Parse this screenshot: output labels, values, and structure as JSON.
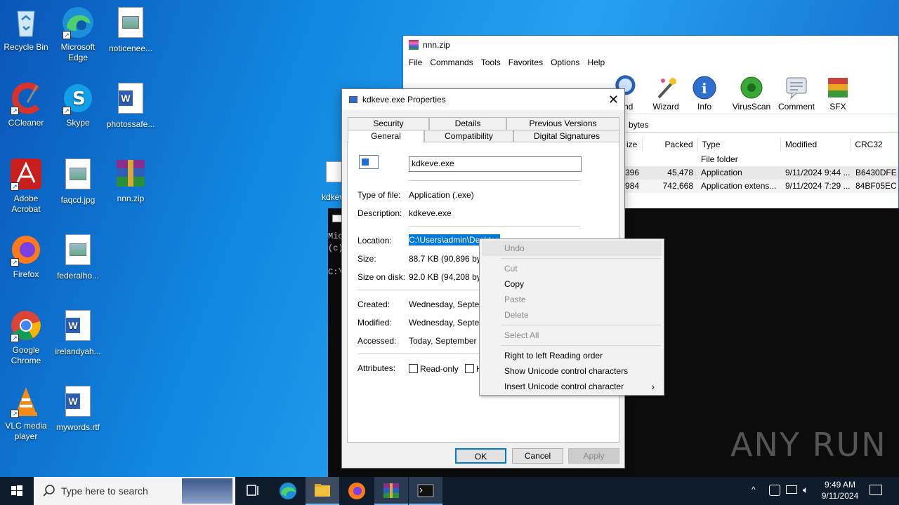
{
  "desktop": {
    "icons": [
      {
        "label": "Recycle Bin"
      },
      {
        "label": "Microsoft Edge"
      },
      {
        "label": "noticenee..."
      },
      {
        "label": "CCleaner"
      },
      {
        "label": "Skype"
      },
      {
        "label": "photossafe..."
      },
      {
        "label": "Adobe Acrobat"
      },
      {
        "label": "faqcd.jpg"
      },
      {
        "label": "nnn.zip"
      },
      {
        "label": "Firefox"
      },
      {
        "label": "federalho..."
      },
      {
        "label": "Google Chrome"
      },
      {
        "label": "irelandyah..."
      },
      {
        "label": "VLC media player"
      },
      {
        "label": "mywords.rtf"
      }
    ],
    "partial_icon_label": "kdkev",
    "watermark": "ANY RUN"
  },
  "winrar": {
    "title": "nnn.zip",
    "menu": [
      "File",
      "Commands",
      "Tools",
      "Favorites",
      "Options",
      "Help"
    ],
    "tools": [
      "nd",
      "Wizard",
      "Info",
      "VirusScan",
      "Comment",
      "SFX"
    ],
    "address_text": "bytes",
    "columns": [
      "ize",
      "Packed",
      "Type",
      "Modified",
      "CRC32"
    ],
    "rows": [
      {
        "size": "",
        "packed": "",
        "type": "File folder",
        "modified": "",
        "crc": ""
      },
      {
        "size": "396",
        "packed": "45,478",
        "type": "Application",
        "modified": "9/11/2024 9:44 ...",
        "crc": "B6430DFE"
      },
      {
        "size": "984",
        "packed": "742,668",
        "type": "Application extens...",
        "modified": "9/11/2024 7:29 ...",
        "crc": "84BF05EC"
      }
    ]
  },
  "console": {
    "lines": [
      "Mic",
      "(c)",
      "",
      "C:\\"
    ]
  },
  "properties": {
    "title": "kdkeve.exe Properties",
    "close": "✕",
    "tabs_top": [
      "Security",
      "Details",
      "Previous Versions"
    ],
    "tabs_bottom": [
      "General",
      "Compatibility",
      "Digital Signatures"
    ],
    "filename": "kdkeve.exe",
    "type_label": "Type of file:",
    "type_value": "Application (.exe)",
    "desc_label": "Description:",
    "desc_value": "kdkeve.exe",
    "location_label": "Location:",
    "location_value": "C:\\Users\\admin\\Desktop",
    "size_label": "Size:",
    "size_value": "88.7 KB (90,896 byte",
    "disk_label": "Size on disk:",
    "disk_value": "92.0 KB (94,208 byte",
    "created_label": "Created:",
    "created_value": "Wednesday, Septemb",
    "modified_label": "Modified:",
    "modified_value": "Wednesday, Septemb",
    "accessed_label": "Accessed:",
    "accessed_value": "Today, September 11",
    "attributes_label": "Attributes:",
    "readonly_label": "Read-only",
    "hidden_label": "H",
    "ok": "OK",
    "cancel": "Cancel",
    "apply": "Apply"
  },
  "context_menu": {
    "items": [
      {
        "label": "Undo",
        "enabled": false
      },
      {
        "label": "Cut",
        "enabled": false
      },
      {
        "label": "Copy",
        "enabled": true
      },
      {
        "label": "Paste",
        "enabled": false
      },
      {
        "label": "Delete",
        "enabled": false
      },
      {
        "label": "Select All",
        "enabled": false
      },
      {
        "label": "Right to left Reading order",
        "enabled": true
      },
      {
        "label": "Show Unicode control characters",
        "enabled": true
      },
      {
        "label": "Insert Unicode control character",
        "enabled": true
      }
    ],
    "submenu_arrow": "›"
  },
  "taskbar": {
    "search_placeholder": "Type here to search",
    "time": "9:49 AM",
    "date": "9/11/2024"
  }
}
